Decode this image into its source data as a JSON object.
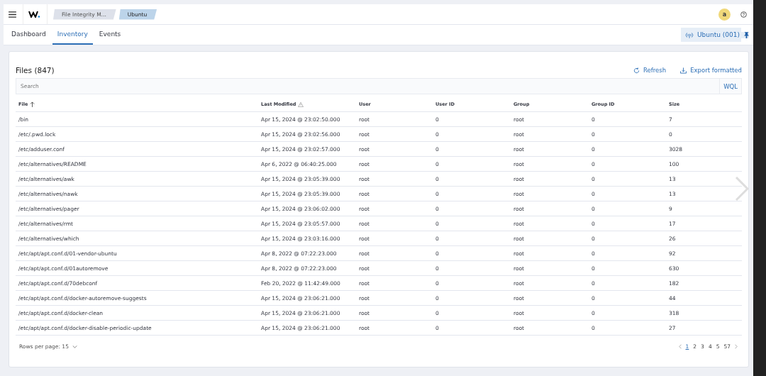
{
  "header": {
    "breadcrumbs": [
      {
        "label": "File Integrity M...",
        "selected": false
      },
      {
        "label": "Ubuntu",
        "selected": true
      }
    ],
    "avatar": "a"
  },
  "tabs": [
    {
      "label": "Dashboard",
      "selected": false
    },
    {
      "label": "Inventory",
      "selected": true
    },
    {
      "label": "Events",
      "selected": false
    }
  ],
  "agent_button": "Ubuntu (001)",
  "panel": {
    "title": "Files (847)",
    "actions": [
      "Refresh",
      "Export formatted"
    ],
    "search": {
      "placeholder": "Search",
      "language": "WQL"
    }
  },
  "table": {
    "columns": [
      {
        "label": "File",
        "sorted": true
      },
      {
        "label": "Last Modified",
        "sorted": false
      },
      {
        "label": "User",
        "sorted": false
      },
      {
        "label": "User ID",
        "sorted": false
      },
      {
        "label": "Group",
        "sorted": false
      },
      {
        "label": "Group ID",
        "sorted": false
      },
      {
        "label": "Size",
        "sorted": false
      }
    ],
    "rows": [
      [
        "/bin",
        "Apr 15, 2024 @ 23:02:50.000",
        "root",
        "0",
        "root",
        "0",
        "7"
      ],
      [
        "/etc/.pwd.lock",
        "Apr 15, 2024 @ 23:02:56.000",
        "root",
        "0",
        "root",
        "0",
        "0"
      ],
      [
        "/etc/adduser.conf",
        "Apr 15, 2024 @ 23:02:57.000",
        "root",
        "0",
        "root",
        "0",
        "3028"
      ],
      [
        "/etc/alternatives/README",
        "Apr 6, 2022 @ 06:40:25.000",
        "root",
        "0",
        "root",
        "0",
        "100"
      ],
      [
        "/etc/alternatives/awk",
        "Apr 15, 2024 @ 23:05:39.000",
        "root",
        "0",
        "root",
        "0",
        "13"
      ],
      [
        "/etc/alternatives/nawk",
        "Apr 15, 2024 @ 23:05:39.000",
        "root",
        "0",
        "root",
        "0",
        "13"
      ],
      [
        "/etc/alternatives/pager",
        "Apr 15, 2024 @ 23:06:02.000",
        "root",
        "0",
        "root",
        "0",
        "9"
      ],
      [
        "/etc/alternatives/rmt",
        "Apr 15, 2024 @ 23:05:57.000",
        "root",
        "0",
        "root",
        "0",
        "17"
      ],
      [
        "/etc/alternatives/which",
        "Apr 15, 2024 @ 23:03:16.000",
        "root",
        "0",
        "root",
        "0",
        "26"
      ],
      [
        "/etc/apt/apt.conf.d/01-vendor-ubuntu",
        "Apr 8, 2022 @ 07:22:23.000",
        "root",
        "0",
        "root",
        "0",
        "92"
      ],
      [
        "/etc/apt/apt.conf.d/01autoremove",
        "Apr 8, 2022 @ 07:22:23.000",
        "root",
        "0",
        "root",
        "0",
        "630"
      ],
      [
        "/etc/apt/apt.conf.d/70debconf",
        "Feb 20, 2022 @ 11:42:49.000",
        "root",
        "0",
        "root",
        "0",
        "182"
      ],
      [
        "/etc/apt/apt.conf.d/docker-autoremove-suggests",
        "Apr 15, 2024 @ 23:06:21.000",
        "root",
        "0",
        "root",
        "0",
        "44"
      ],
      [
        "/etc/apt/apt.conf.d/docker-clean",
        "Apr 15, 2024 @ 23:06:21.000",
        "root",
        "0",
        "root",
        "0",
        "318"
      ],
      [
        "/etc/apt/apt.conf.d/docker-disable-periodic-update",
        "Apr 15, 2024 @ 23:06:21.000",
        "root",
        "0",
        "root",
        "0",
        "27"
      ]
    ]
  },
  "footer": {
    "rows_per_page": "Rows per page: 15",
    "pages": [
      {
        "label": "1",
        "selected": true
      },
      {
        "label": "2",
        "selected": false
      },
      {
        "label": "3",
        "selected": false
      },
      {
        "label": "4",
        "selected": false
      },
      {
        "label": "5",
        "selected": false
      },
      {
        "label": "57",
        "selected": false
      }
    ]
  }
}
